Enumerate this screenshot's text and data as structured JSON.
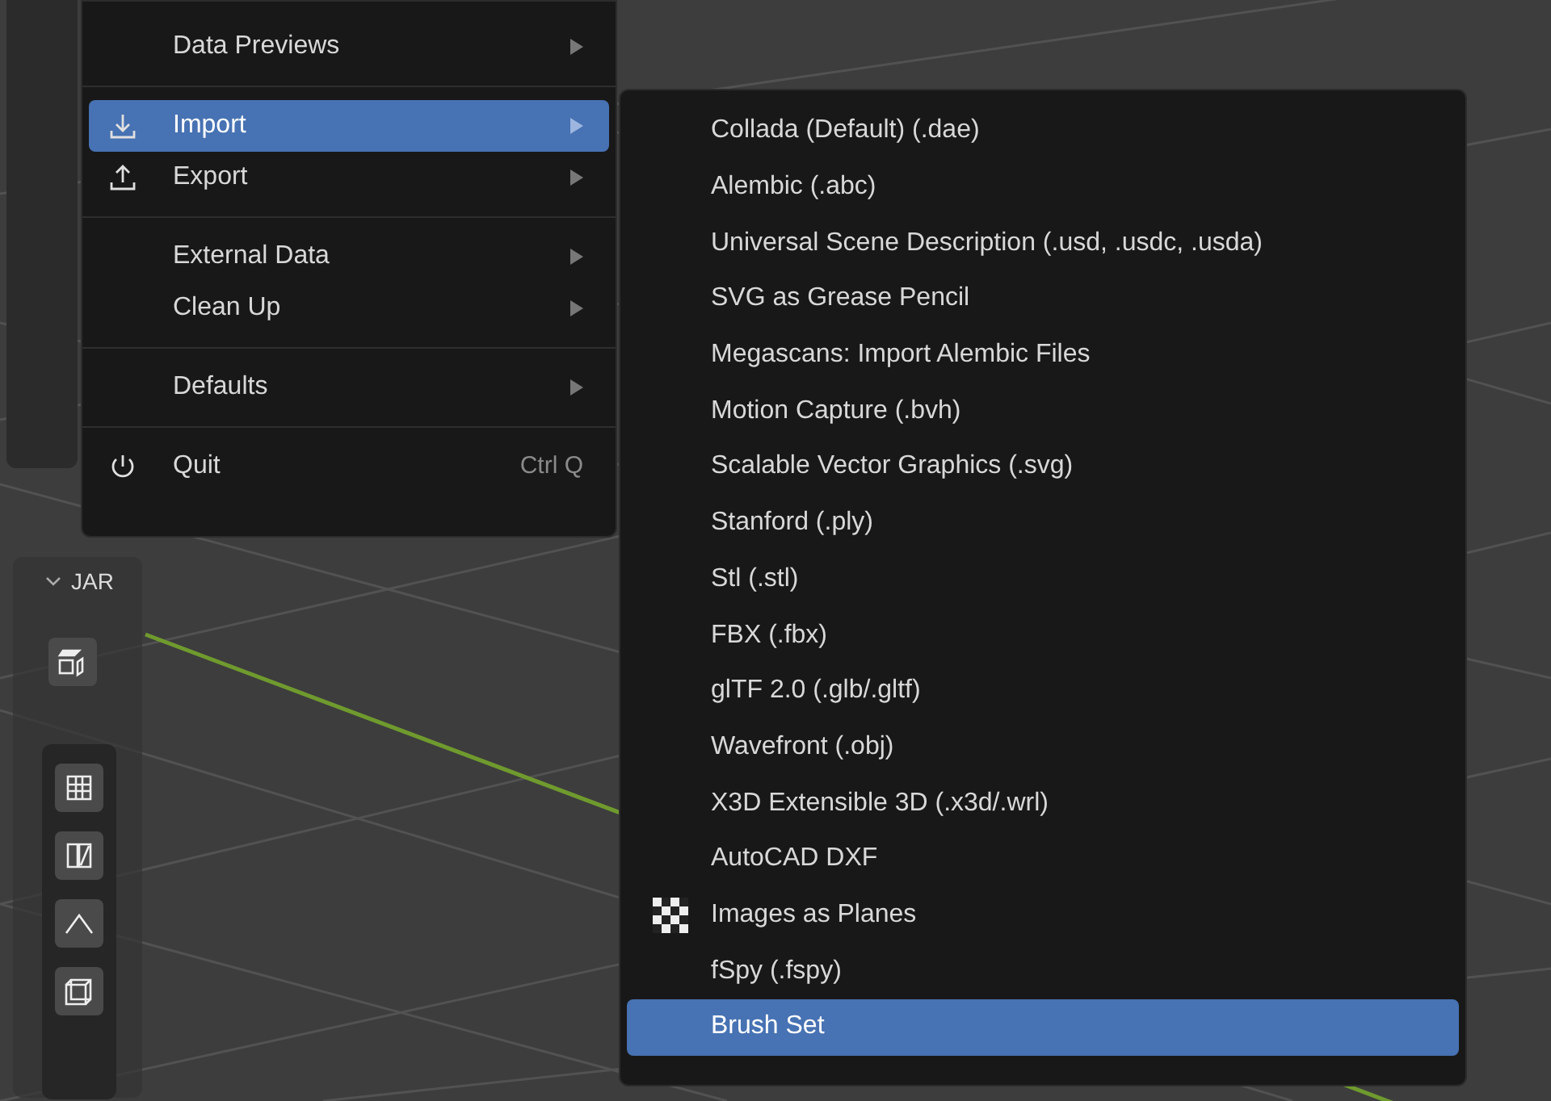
{
  "file_menu": {
    "items": [
      {
        "kind": "submenu",
        "label": "Data Previews",
        "selected": false
      },
      {
        "kind": "separator"
      },
      {
        "kind": "submenu",
        "label": "Import",
        "selected": true
      },
      {
        "kind": "submenu",
        "label": "Export",
        "selected": false
      },
      {
        "kind": "separator"
      },
      {
        "kind": "submenu",
        "label": "External Data",
        "selected": false
      },
      {
        "kind": "submenu",
        "label": "Clean Up",
        "selected": false
      },
      {
        "kind": "separator"
      },
      {
        "kind": "submenu",
        "label": "Defaults",
        "selected": false
      },
      {
        "kind": "separator"
      },
      {
        "kind": "action",
        "label": "Quit",
        "shortcut": "Ctrl Q",
        "selected": false
      }
    ]
  },
  "import_menu": {
    "items": [
      {
        "label": "Collada (Default) (.dae)",
        "selected": false
      },
      {
        "label": "Alembic (.abc)",
        "selected": false
      },
      {
        "label": "Universal Scene Description (.usd, .usdc, .usda)",
        "selected": false
      },
      {
        "label": "SVG as Grease Pencil",
        "selected": false
      },
      {
        "label": "Megascans: Import Alembic Files",
        "selected": false
      },
      {
        "label": "Motion Capture (.bvh)",
        "selected": false
      },
      {
        "label": "Scalable Vector Graphics (.svg)",
        "selected": false
      },
      {
        "label": "Stanford (.ply)",
        "selected": false
      },
      {
        "label": "Stl (.stl)",
        "selected": false
      },
      {
        "label": "FBX (.fbx)",
        "selected": false
      },
      {
        "label": "glTF 2.0 (.glb/.gltf)",
        "selected": false
      },
      {
        "label": "Wavefront (.obj)",
        "selected": false
      },
      {
        "label": "X3D Extensible 3D (.x3d/.wrl)",
        "selected": false
      },
      {
        "label": "AutoCAD DXF",
        "selected": false
      },
      {
        "label": "Images as Planes",
        "selected": false
      },
      {
        "label": "fSpy (.fspy)",
        "selected": false
      },
      {
        "label": "Brush Set",
        "selected": true
      }
    ]
  },
  "sidebar_panel": {
    "title": "JAR",
    "expanded": true
  }
}
